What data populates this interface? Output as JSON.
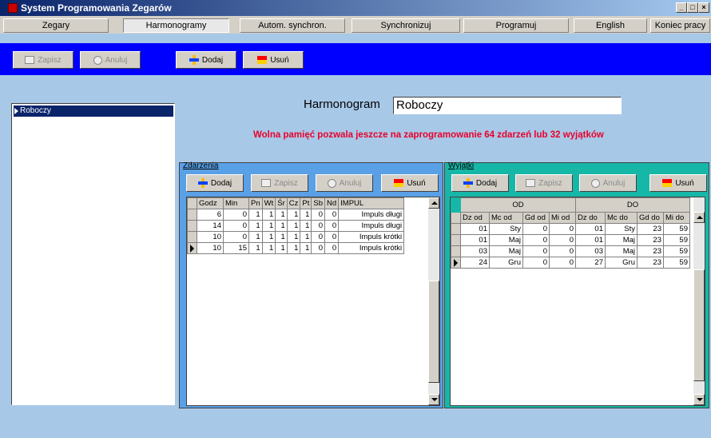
{
  "title": "System Programowania Zegarów",
  "window_buttons": [
    "_",
    "□",
    "×"
  ],
  "menu": [
    "Zegary",
    "Harmonogramy",
    "Autom. synchron.",
    "Synchronizuj",
    "Programuj",
    "English",
    "Koniec pracy"
  ],
  "toolbar": {
    "save": "Zapisz",
    "cancel": "Anuluj",
    "add": "Dodaj",
    "delete": "Usuń"
  },
  "list": [
    "Roboczy"
  ],
  "harmonogram": {
    "label": "Harmonogram",
    "value": "Roboczy"
  },
  "warning": "Wolna pamięć pozwala jeszcze na zaprogramowanie 64  zdarzeń lub 32  wyjątków",
  "events": {
    "title": "Zdarzenia",
    "buttons": {
      "add": "Dodaj",
      "save": "Zapisz",
      "cancel": "Anuluj",
      "delete": "Usuń"
    },
    "columns": [
      "Godz",
      "Min",
      "Pn",
      "Wt",
      "Śr",
      "Cz",
      "Pt",
      "Sb",
      "Nd",
      "IMPUL"
    ],
    "rows": [
      [
        "6",
        "0",
        "1",
        "1",
        "1",
        "1",
        "1",
        "0",
        "0",
        "Impuls długi"
      ],
      [
        "14",
        "0",
        "1",
        "1",
        "1",
        "1",
        "1",
        "0",
        "0",
        "Impuls długi"
      ],
      [
        "10",
        "0",
        "1",
        "1",
        "1",
        "1",
        "1",
        "0",
        "0",
        "Impuls krótki"
      ],
      [
        "10",
        "15",
        "1",
        "1",
        "1",
        "1",
        "1",
        "0",
        "0",
        "Impuls krótki"
      ]
    ]
  },
  "exceptions": {
    "title": "Wyjątki",
    "buttons": {
      "add": "Dodaj",
      "save": "Zapisz",
      "cancel": "Anuluj",
      "delete": "Usuń"
    },
    "groups": [
      "OD",
      "DO"
    ],
    "columns": [
      "Dz od",
      "Mc od",
      "Gd od",
      "Mi od",
      "Dz do",
      "Mc do",
      "Gd do",
      "Mi do"
    ],
    "rows": [
      [
        "01",
        "Sty",
        "0",
        "0",
        "01",
        "Sty",
        "23",
        "59"
      ],
      [
        "01",
        "Maj",
        "0",
        "0",
        "01",
        "Maj",
        "23",
        "59"
      ],
      [
        "03",
        "Maj",
        "0",
        "0",
        "03",
        "Maj",
        "23",
        "59"
      ],
      [
        "24",
        "Gru",
        "0",
        "0",
        "27",
        "Gru",
        "23",
        "59"
      ]
    ]
  },
  "colors": {
    "toolbar": "#0000ff",
    "background": "#a8c8e8",
    "events_panel": "#5aa0e6",
    "exceptions_panel": "#17b7a8",
    "warning": "#e8002a"
  }
}
